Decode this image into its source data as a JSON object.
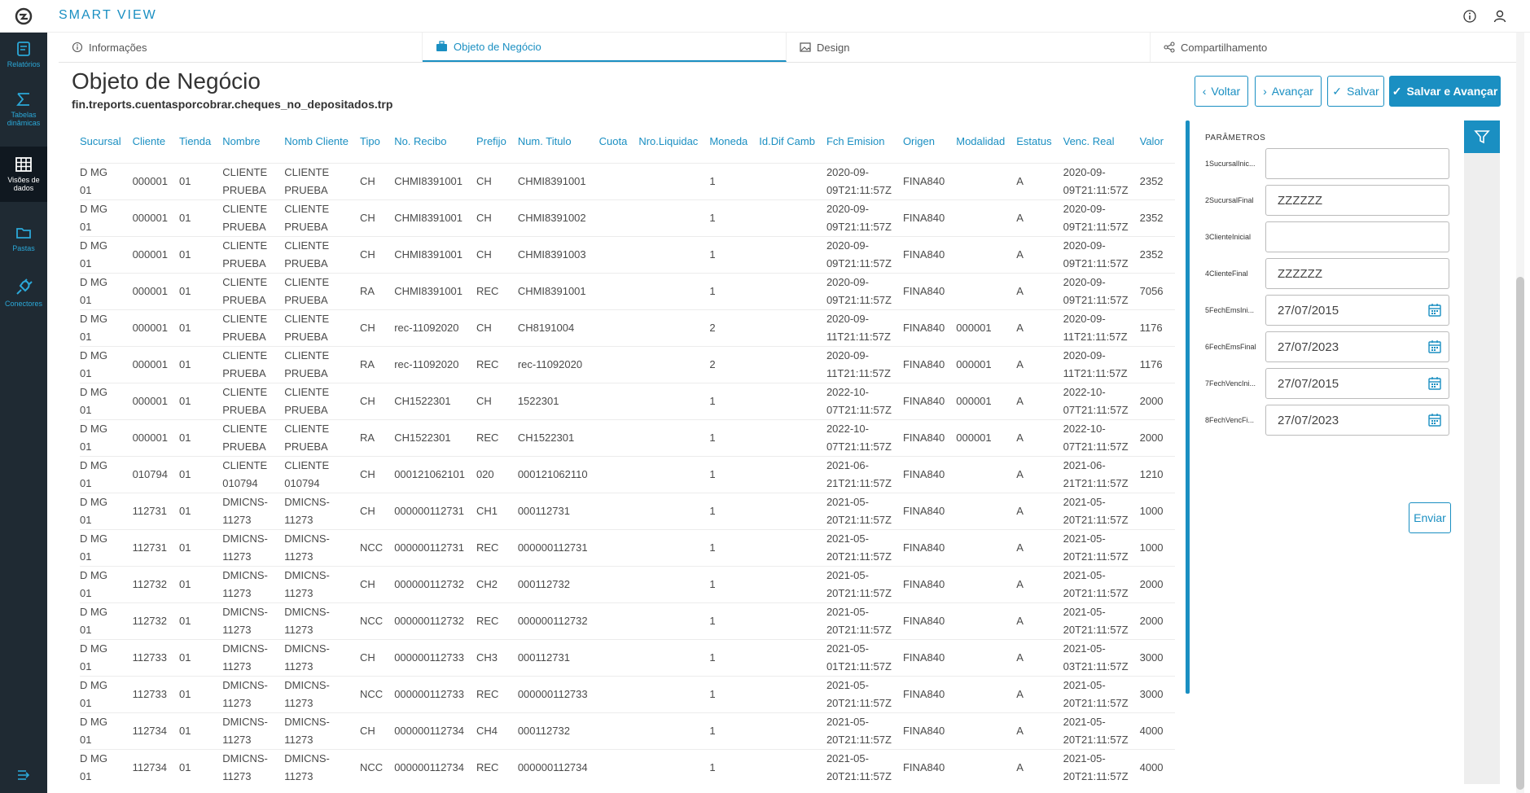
{
  "app": {
    "brand": "SMART VIEW"
  },
  "sidebar": {
    "items": [
      {
        "label": "Relatórios",
        "icon": "report-icon"
      },
      {
        "label": "Tabelas dinâmicas",
        "icon": "pivot-table-icon"
      },
      {
        "label": "Visões de dados",
        "icon": "data-grid-icon"
      },
      {
        "label": "Pastas",
        "icon": "folder-icon"
      },
      {
        "label": "Conectores",
        "icon": "plug-icon"
      }
    ]
  },
  "tabs": [
    {
      "label": "Informações",
      "icon": "info-icon"
    },
    {
      "label": "Objeto de Negócio",
      "icon": "briefcase-icon"
    },
    {
      "label": "Design",
      "icon": "image-icon"
    },
    {
      "label": "Compartilhamento",
      "icon": "share-icon"
    }
  ],
  "page": {
    "title": "Objeto de Negócio",
    "subtitle": "fin.treports.cuentasporcobrar.cheques_no_depositados.trp"
  },
  "actions": {
    "voltar": "Voltar",
    "avancar": "Avançar",
    "salvar": "Salvar",
    "salvar_avancar": "Salvar e Avançar"
  },
  "table": {
    "columns": [
      "Sucursal",
      "Cliente",
      "Tienda",
      "Nombre",
      "Nomb Cliente",
      "Tipo",
      "No. Recibo",
      "Prefijo",
      "Num. Titulo",
      "Cuota",
      "Nro.Liquidac",
      "Moneda",
      "Id.Dif Camb",
      "Fch Emision",
      "Origen",
      "Modalidad",
      "Estatus",
      "Venc. Real",
      "Valor"
    ],
    "rows": [
      [
        "D MG 01",
        "000001",
        "01",
        "CLIENTE PRUEBA",
        "CLIENTE PRUEBA",
        "CH",
        "CHMI8391001",
        "CH",
        "CHMI8391001",
        "",
        "",
        "1",
        "",
        "2020-09-09T21:11:57Z",
        "FINA840",
        "",
        "A",
        "2020-09-09T21:11:57Z",
        "2352"
      ],
      [
        "D MG 01",
        "000001",
        "01",
        "CLIENTE PRUEBA",
        "CLIENTE PRUEBA",
        "CH",
        "CHMI8391001",
        "CH",
        "CHMI8391002",
        "",
        "",
        "1",
        "",
        "2020-09-09T21:11:57Z",
        "FINA840",
        "",
        "A",
        "2020-09-09T21:11:57Z",
        "2352"
      ],
      [
        "D MG 01",
        "000001",
        "01",
        "CLIENTE PRUEBA",
        "CLIENTE PRUEBA",
        "CH",
        "CHMI8391001",
        "CH",
        "CHMI8391003",
        "",
        "",
        "1",
        "",
        "2020-09-09T21:11:57Z",
        "FINA840",
        "",
        "A",
        "2020-09-09T21:11:57Z",
        "2352"
      ],
      [
        "D MG 01",
        "000001",
        "01",
        "CLIENTE PRUEBA",
        "CLIENTE PRUEBA",
        "RA",
        "CHMI8391001",
        "REC",
        "CHMI8391001",
        "",
        "",
        "1",
        "",
        "2020-09-09T21:11:57Z",
        "FINA840",
        "",
        "A",
        "2020-09-09T21:11:57Z",
        "7056"
      ],
      [
        "D MG 01",
        "000001",
        "01",
        "CLIENTE PRUEBA",
        "CLIENTE PRUEBA",
        "CH",
        "rec-11092020",
        "CH",
        "CH8191004",
        "",
        "",
        "2",
        "",
        "2020-09-11T21:11:57Z",
        "FINA840",
        "000001",
        "A",
        "2020-09-11T21:11:57Z",
        "1176"
      ],
      [
        "D MG 01",
        "000001",
        "01",
        "CLIENTE PRUEBA",
        "CLIENTE PRUEBA",
        "RA",
        "rec-11092020",
        "REC",
        "rec-11092020",
        "",
        "",
        "2",
        "",
        "2020-09-11T21:11:57Z",
        "FINA840",
        "000001",
        "A",
        "2020-09-11T21:11:57Z",
        "1176"
      ],
      [
        "D MG 01",
        "000001",
        "01",
        "CLIENTE PRUEBA",
        "CLIENTE PRUEBA",
        "CH",
        "CH1522301",
        "CH",
        "1522301",
        "",
        "",
        "1",
        "",
        "2022-10-07T21:11:57Z",
        "FINA840",
        "000001",
        "A",
        "2022-10-07T21:11:57Z",
        "2000"
      ],
      [
        "D MG 01",
        "000001",
        "01",
        "CLIENTE PRUEBA",
        "CLIENTE PRUEBA",
        "RA",
        "CH1522301",
        "REC",
        "CH1522301",
        "",
        "",
        "1",
        "",
        "2022-10-07T21:11:57Z",
        "FINA840",
        "000001",
        "A",
        "2022-10-07T21:11:57Z",
        "2000"
      ],
      [
        "D MG 01",
        "010794",
        "01",
        "CLIENTE 010794",
        "CLIENTE 010794",
        "CH",
        "000121062101",
        "020",
        "000121062110",
        "",
        "",
        "1",
        "",
        "2021-06-21T21:11:57Z",
        "FINA840",
        "",
        "A",
        "2021-06-21T21:11:57Z",
        "1210"
      ],
      [
        "D MG 01",
        "112731",
        "01",
        "DMICNS-11273",
        "DMICNS-11273",
        "CH",
        "000000112731",
        "CH1",
        "000112731",
        "",
        "",
        "1",
        "",
        "2021-05-20T21:11:57Z",
        "FINA840",
        "",
        "A",
        "2021-05-20T21:11:57Z",
        "1000"
      ],
      [
        "D MG 01",
        "112731",
        "01",
        "DMICNS-11273",
        "DMICNS-11273",
        "NCC",
        "000000112731",
        "REC",
        "000000112731",
        "",
        "",
        "1",
        "",
        "2021-05-20T21:11:57Z",
        "FINA840",
        "",
        "A",
        "2021-05-20T21:11:57Z",
        "1000"
      ],
      [
        "D MG 01",
        "112732",
        "01",
        "DMICNS-11273",
        "DMICNS-11273",
        "CH",
        "000000112732",
        "CH2",
        "000112732",
        "",
        "",
        "1",
        "",
        "2021-05-20T21:11:57Z",
        "FINA840",
        "",
        "A",
        "2021-05-20T21:11:57Z",
        "2000"
      ],
      [
        "D MG 01",
        "112732",
        "01",
        "DMICNS-11273",
        "DMICNS-11273",
        "NCC",
        "000000112732",
        "REC",
        "000000112732",
        "",
        "",
        "1",
        "",
        "2021-05-20T21:11:57Z",
        "FINA840",
        "",
        "A",
        "2021-05-20T21:11:57Z",
        "2000"
      ],
      [
        "D MG 01",
        "112733",
        "01",
        "DMICNS-11273",
        "DMICNS-11273",
        "CH",
        "000000112733",
        "CH3",
        "000112731",
        "",
        "",
        "1",
        "",
        "2021-05-01T21:11:57Z",
        "FINA840",
        "",
        "A",
        "2021-05-03T21:11:57Z",
        "3000"
      ],
      [
        "D MG 01",
        "112733",
        "01",
        "DMICNS-11273",
        "DMICNS-11273",
        "NCC",
        "000000112733",
        "REC",
        "000000112733",
        "",
        "",
        "1",
        "",
        "2021-05-20T21:11:57Z",
        "FINA840",
        "",
        "A",
        "2021-05-20T21:11:57Z",
        "3000"
      ],
      [
        "D MG 01",
        "112734",
        "01",
        "DMICNS-11273",
        "DMICNS-11273",
        "CH",
        "000000112734",
        "CH4",
        "000112732",
        "",
        "",
        "1",
        "",
        "2021-05-20T21:11:57Z",
        "FINA840",
        "",
        "A",
        "2021-05-20T21:11:57Z",
        "4000"
      ],
      [
        "D MG 01",
        "112734",
        "01",
        "DMICNS-11273",
        "DMICNS-11273",
        "NCC",
        "000000112734",
        "REC",
        "000000112734",
        "",
        "",
        "1",
        "",
        "2021-05-20T21:11:57Z",
        "FINA840",
        "",
        "A",
        "2021-05-20T21:11:57Z",
        "4000"
      ],
      [
        "D MG",
        "",
        "",
        "DMICNS-",
        "DMICNS-",
        "",
        "",
        "",
        "",
        "",
        "",
        "",
        "",
        "2021-05-",
        "",
        "",
        "",
        "2021-05-",
        ""
      ]
    ]
  },
  "params": {
    "title": "PARÂMETROS",
    "fields": [
      {
        "label": "1SucursalInic...",
        "value": "",
        "type": "text"
      },
      {
        "label": "2SucursalFinal",
        "value": "ZZZZZZ",
        "type": "text"
      },
      {
        "label": "3ClienteInicial",
        "value": "",
        "type": "text"
      },
      {
        "label": "4ClienteFinal",
        "value": "ZZZZZZ",
        "type": "text"
      },
      {
        "label": "5FechEmsIni...",
        "value": "27/07/2015",
        "type": "date"
      },
      {
        "label": "6FechEmsFinal",
        "value": "27/07/2023",
        "type": "date"
      },
      {
        "label": "7FechVencIni...",
        "value": "27/07/2015",
        "type": "date"
      },
      {
        "label": "8FechVencFi...",
        "value": "27/07/2023",
        "type": "date"
      }
    ],
    "submit": "Enviar"
  },
  "colors": {
    "accent": "#1a8fc2",
    "sidebar": "#1f2a33"
  }
}
